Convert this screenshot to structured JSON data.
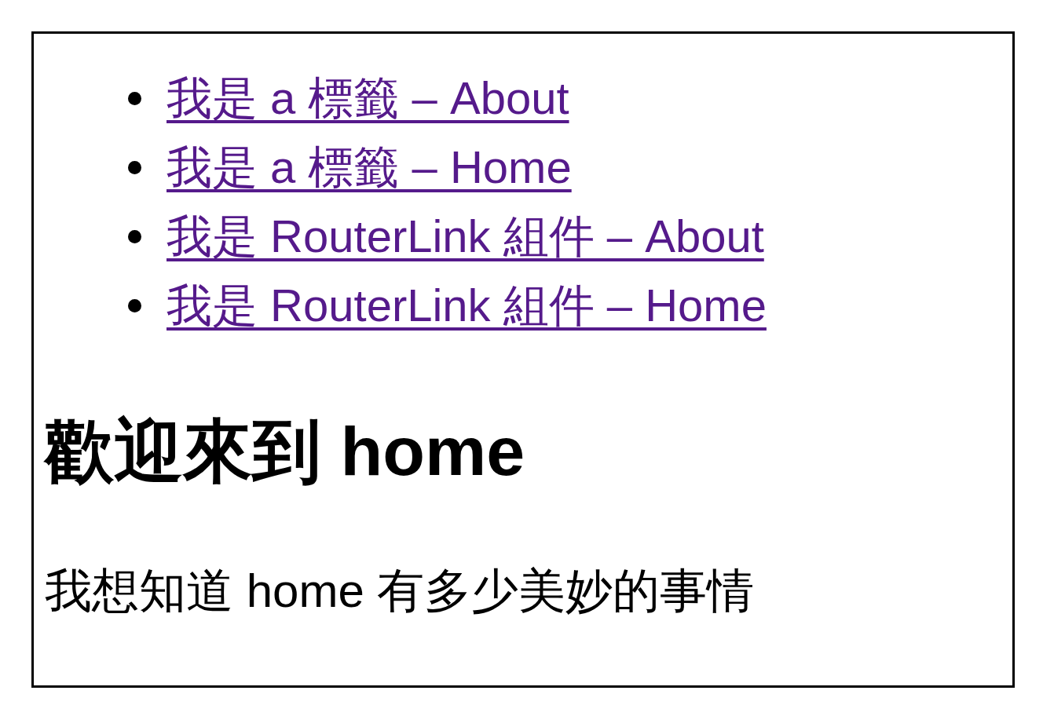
{
  "nav_links": [
    {
      "label": "我是 a 標籤 – About"
    },
    {
      "label": "我是 a 標籤 – Home"
    },
    {
      "label": "我是 RouterLink 組件 – About"
    },
    {
      "label": "我是 RouterLink 組件 – Home"
    }
  ],
  "heading": "歡迎來到 home",
  "paragraph": "我想知道 home 有多少美妙的事情"
}
